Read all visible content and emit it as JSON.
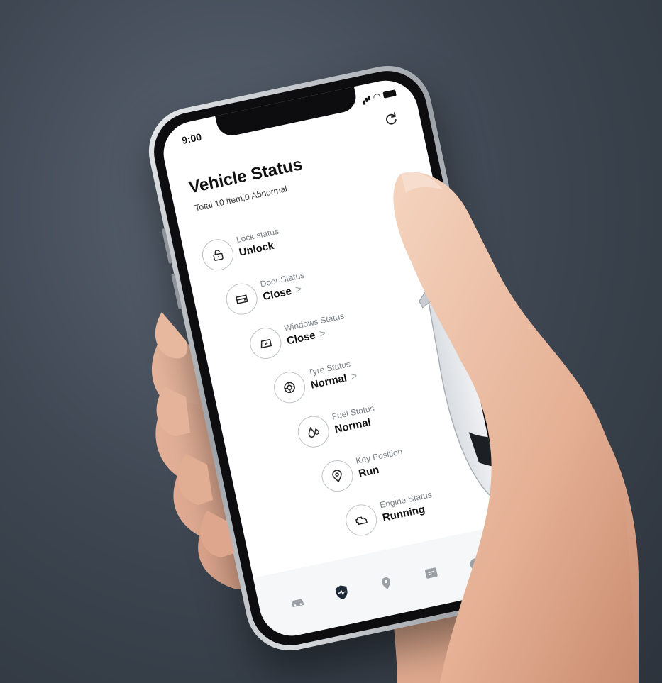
{
  "status_bar": {
    "time": "9:00"
  },
  "header": {
    "title": "Vehicle Status",
    "subtitle": "Total 10 Item,0 Abnormal",
    "refresh_icon": "refresh-icon"
  },
  "items": [
    {
      "label": "Lock status",
      "value": "Unlock",
      "chevron": "",
      "icon": "lock-icon"
    },
    {
      "label": "Door Status",
      "value": "Close",
      "chevron": ">",
      "icon": "door-icon"
    },
    {
      "label": "Windows Status",
      "value": "Close",
      "chevron": ">",
      "icon": "window-icon"
    },
    {
      "label": "Tyre Status",
      "value": "Normal",
      "chevron": ">",
      "icon": "tyre-icon"
    },
    {
      "label": "Fuel Status",
      "value": "Normal",
      "chevron": "",
      "icon": "fuel-icon"
    },
    {
      "label": "Key Position",
      "value": "Run",
      "chevron": "",
      "icon": "location-pin-icon"
    },
    {
      "label": "Engine Status",
      "value": "Running",
      "chevron": "",
      "icon": "engine-icon"
    }
  ],
  "tab_bar": {
    "tabs": [
      {
        "icon": "car-icon",
        "active": false
      },
      {
        "icon": "shield-pulse-icon",
        "active": true
      },
      {
        "icon": "map-pin-icon",
        "active": false
      },
      {
        "icon": "message-icon",
        "active": false
      },
      {
        "icon": "profile-icon",
        "active": false
      }
    ]
  },
  "colors": {
    "background": "#3f4853",
    "screen": "#ffffff",
    "text_primary": "#111111",
    "text_secondary": "#7a7f85",
    "icon_border": "#bfc3c7",
    "tab_active": "#1d2a38",
    "tab_inactive": "#9aa0a6"
  }
}
